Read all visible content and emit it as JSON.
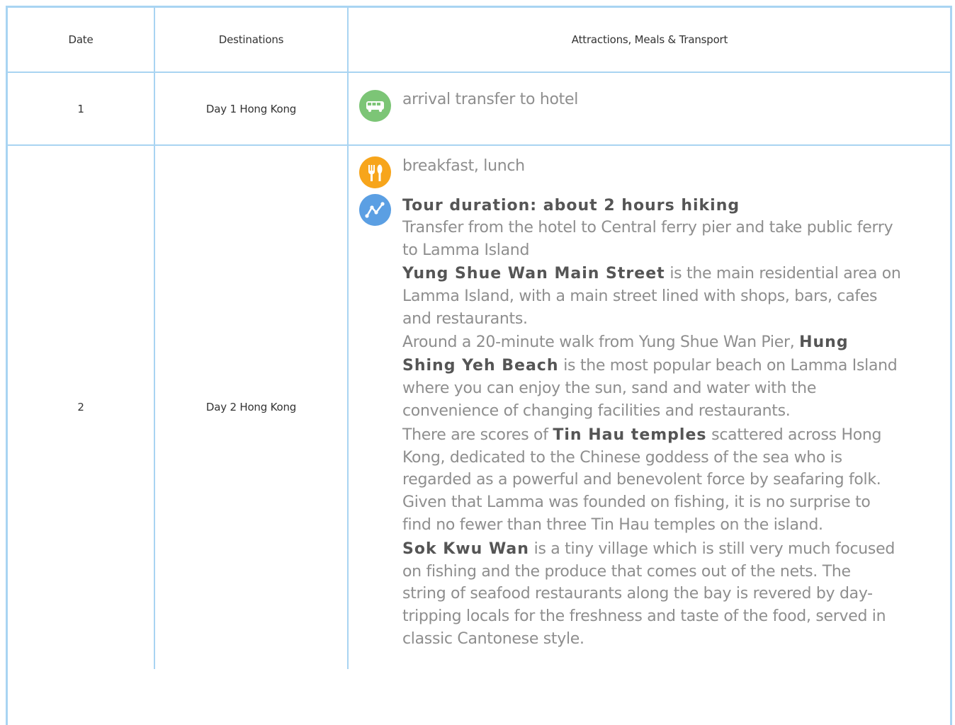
{
  "table": {
    "headers": {
      "date": "Date",
      "destinations": "Destinations",
      "attractions": "Attractions, Meals & Transport"
    },
    "rows": [
      {
        "date": "1",
        "destination": "Day 1 Hong Kong",
        "items": [
          {
            "icon": "bus-icon",
            "color": "#7cc576",
            "text": "arrival transfer to hotel"
          }
        ]
      },
      {
        "date": "2",
        "destination": "Day 2 Hong Kong",
        "meals": {
          "icon": "meal-icon",
          "color": "#f7a51b",
          "text": "breakfast, lunch"
        },
        "tour": {
          "icon": "route-icon",
          "color": "#5b9fe3",
          "title": "Tour duration: about 2 hours hiking",
          "l1": "Transfer from the hotel to Central ferry pier and take public ferry",
          "l2": "to Lamma Island",
          "b1": "Yung Shue Wan Main Street",
          "l3": " is the main residential area on",
          "l4": "Lamma Island, with a main street lined with shops, bars, cafes",
          "l5": "and restaurants.",
          "l6": "Around a 20-minute walk from Yung Shue Wan Pier, ",
          "b2a": "Hung",
          "b2b": "Shing Yeh Beach",
          "l7": " is the most popular beach on Lamma Island",
          "l8": "where you can enjoy the sun, sand and water with the",
          "l9": "convenience of changing facilities and restaurants.",
          "l10": "There are scores of ",
          "b3": "Tin Hau temples",
          "l11": " scattered across Hong",
          "l12": "Kong, dedicated to the Chinese goddess of the sea who is",
          "l13": "regarded as a powerful and benevolent force by seafaring folk.",
          "l14": "Given that Lamma was founded on fishing, it is no surprise to",
          "l15": "find no fewer than three Tin Hau temples on the island.",
          "b4": "Sok Kwu Wan",
          "l16": " is a tiny village which is still very much focused",
          "l17": "on fishing  and the produce that comes out of the nets. The",
          "l18": "string of seafood restaurants along the bay is revered by day-",
          "l19": "tripping locals for the freshness and taste of the food, served in",
          "l20": "classic Cantonese style."
        }
      }
    ]
  }
}
